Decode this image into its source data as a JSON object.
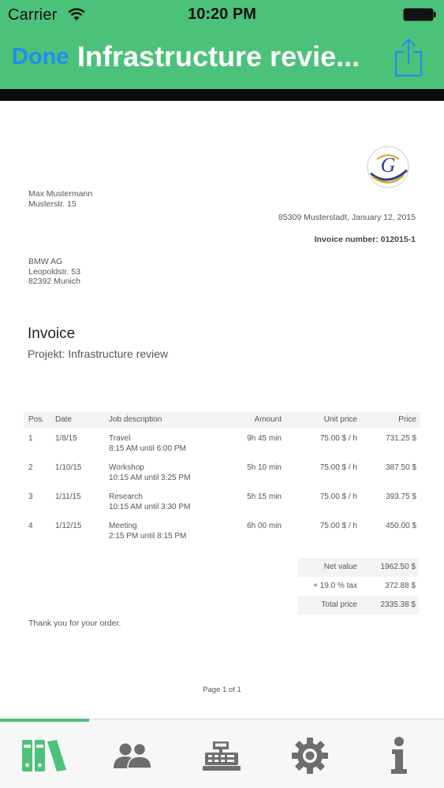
{
  "status_bar": {
    "carrier": "Carrier",
    "time": "10:20 PM"
  },
  "nav": {
    "done_label": "Done",
    "title": "Infrastructure revie..."
  },
  "document": {
    "sender": [
      "Max Mustermann",
      "Musterstr. 15"
    ],
    "place_date": "85309 Musterstadt, January 12, 2015",
    "invoice_number": "Invoice number: 012015-1",
    "recipient": [
      "BMW AG",
      "Leopoldstr. 53",
      "82392 Munich"
    ],
    "title": "Invoice",
    "subtitle": "Projekt: Infrastructure review",
    "table": {
      "headers": [
        "Pos.",
        "Date",
        "Job description",
        "Amount",
        "Unit price",
        "Price"
      ],
      "rows": [
        {
          "pos": "1",
          "date": "1/8/15",
          "job": "Travel",
          "time": "8:15 AM until 6:00 PM",
          "amount": "9h 45 min",
          "unit": "75.00 $ / h",
          "price": "731.25 $"
        },
        {
          "pos": "2",
          "date": "1/10/15",
          "job": "Workshop",
          "time": "10:15 AM until 3:25 PM",
          "amount": "5h 10 min",
          "unit": "75.00 $ / h",
          "price": "387.50 $"
        },
        {
          "pos": "3",
          "date": "1/11/15",
          "job": "Research",
          "time": "10:15 AM until 3:30 PM",
          "amount": "5h 15 min",
          "unit": "75.00 $ / h",
          "price": "393.75 $"
        },
        {
          "pos": "4",
          "date": "1/12/15",
          "job": "Meeting",
          "time": "2:15 PM until 8:15 PM",
          "amount": "6h 00 min",
          "unit": "75.00 $ / h",
          "price": "450.00 $"
        }
      ]
    },
    "totals": {
      "net_label": "Net value",
      "net_value": "1962.50 $",
      "tax_label": "+ 19.0 % tax",
      "tax_value": "372.88 $",
      "total_label": "Total price",
      "total_value": "2335.38 $"
    },
    "thanks": "Thank you for your order.",
    "page": "Page 1 of 1"
  },
  "tabbar": {
    "tabs": [
      {
        "icon": "binders-icon",
        "selected": true
      },
      {
        "icon": "users-icon",
        "selected": false
      },
      {
        "icon": "cash-register-icon",
        "selected": false
      },
      {
        "icon": "gear-icon",
        "selected": false
      },
      {
        "icon": "info-icon",
        "selected": false
      }
    ]
  },
  "colors": {
    "nav_background": "#4cc17a",
    "done_blue": "#1f8ef1",
    "share_blue": "#1f8ef1",
    "tab_selected": "#4cc17a",
    "tab_icon": "#6e6e6e"
  }
}
